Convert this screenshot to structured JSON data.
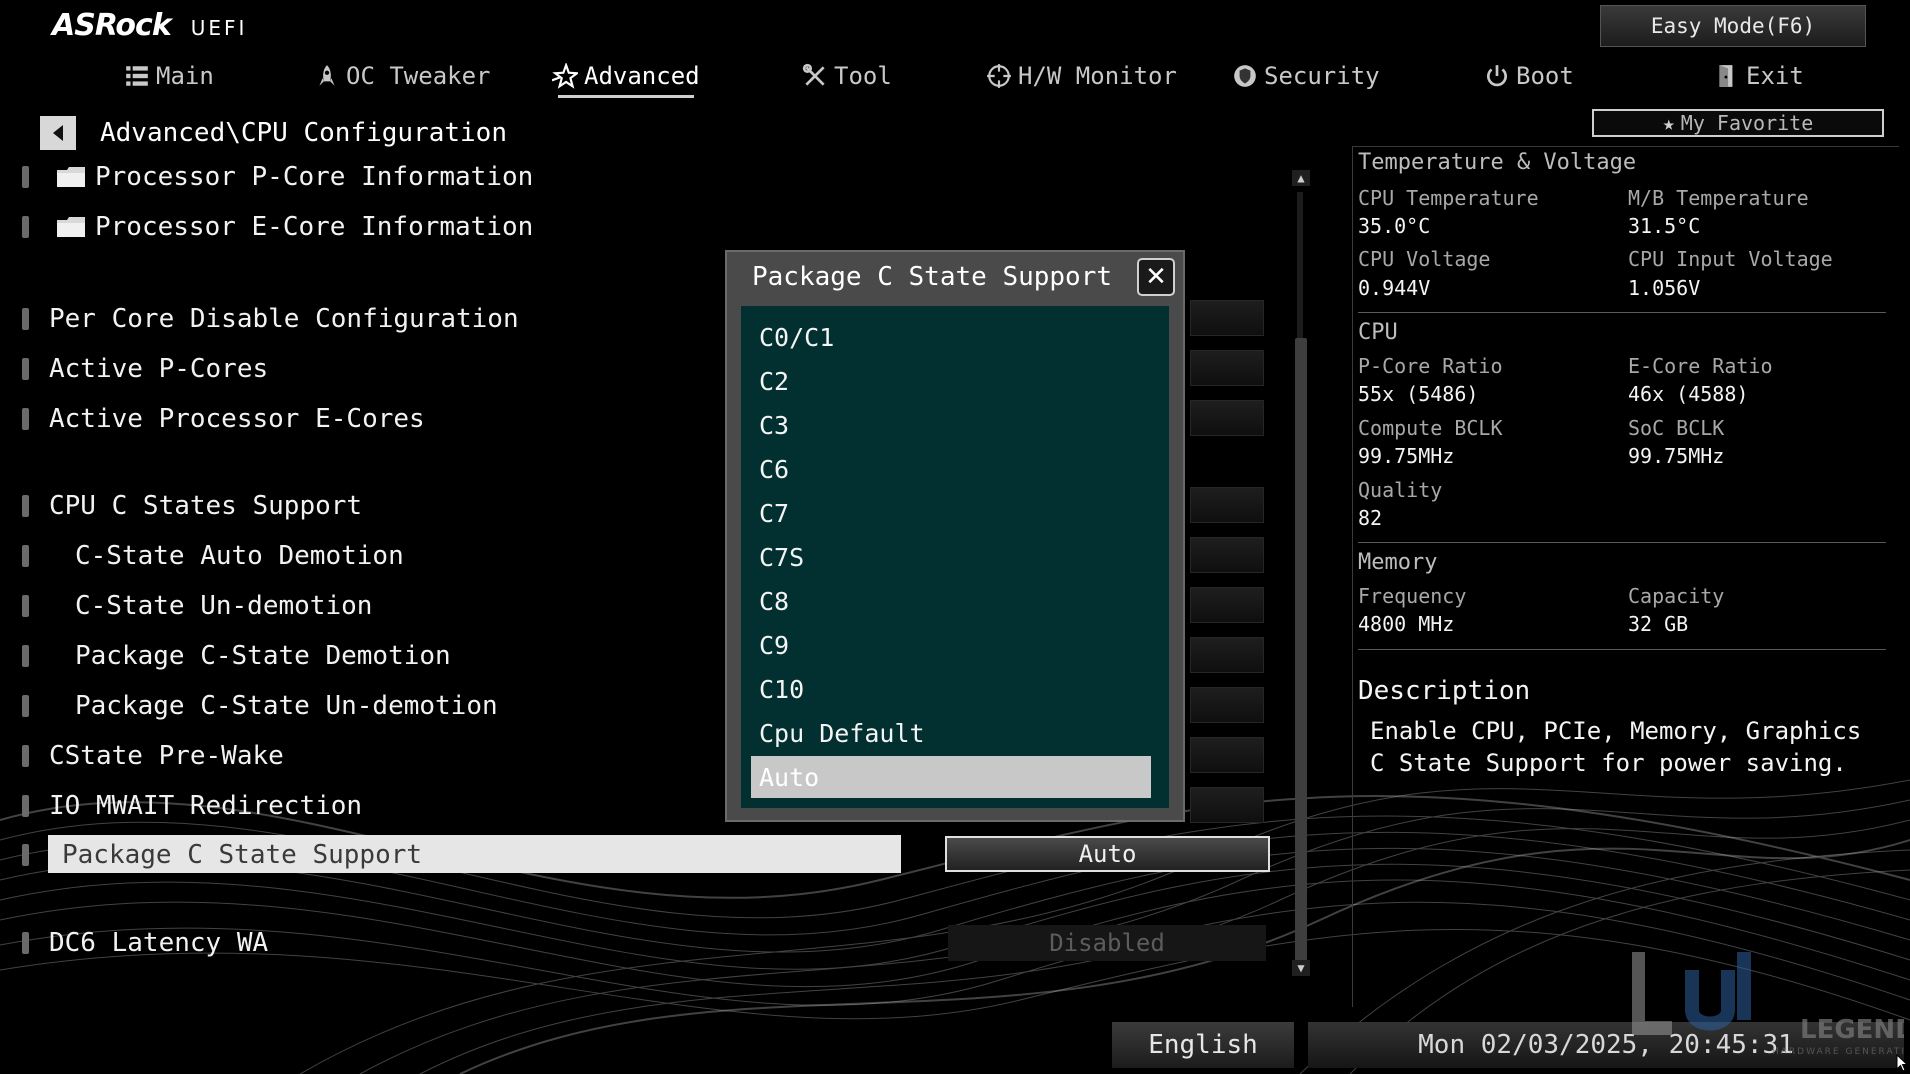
{
  "header": {
    "brand": "ASRock",
    "subbrand": "UEFI",
    "easy_mode": "Easy Mode(F6)",
    "my_favorite": "My Favorite"
  },
  "nav": [
    {
      "label": "Main",
      "icon": "list-icon",
      "active": false
    },
    {
      "label": "OC Tweaker",
      "icon": "rocket-icon",
      "active": false
    },
    {
      "label": "Advanced",
      "icon": "star-icon",
      "active": true
    },
    {
      "label": "Tool",
      "icon": "tools-icon",
      "active": false
    },
    {
      "label": "H/W Monitor",
      "icon": "crosshair-icon",
      "active": false
    },
    {
      "label": "Security",
      "icon": "shield-icon",
      "active": false
    },
    {
      "label": "Boot",
      "icon": "power-icon",
      "active": false
    },
    {
      "label": "Exit",
      "icon": "exit-door-icon",
      "active": false
    }
  ],
  "breadcrumb": "Advanced\\CPU Configuration",
  "settings": [
    {
      "label": "Processor P-Core Information",
      "folder": true
    },
    {
      "label": "Processor E-Core Information",
      "folder": true
    },
    {
      "label": "Per Core Disable Configuration"
    },
    {
      "label": "Active P-Cores"
    },
    {
      "label": "Active Processor E-Cores"
    },
    {
      "label": "CPU C States Support"
    },
    {
      "label": "C-State Auto Demotion",
      "indent": true
    },
    {
      "label": "C-State Un-demotion",
      "indent": true
    },
    {
      "label": "Package C-State Demotion",
      "indent": true
    },
    {
      "label": "Package C-State Un-demotion",
      "indent": true
    },
    {
      "label": "CState Pre-Wake"
    },
    {
      "label": "IO MWAIT Redirection"
    },
    {
      "label": "Package C State Support",
      "selected": true,
      "value": "Auto"
    },
    {
      "label": "DC6 Latency WA",
      "value": "Disabled"
    }
  ],
  "popup": {
    "title": "Package C State Support",
    "options": [
      "C0/C1",
      "C2",
      "C3",
      "C6",
      "C7",
      "C7S",
      "C8",
      "C9",
      "C10",
      "Cpu Default",
      "Auto"
    ],
    "selected": "Auto"
  },
  "info": {
    "temp_voltage": {
      "title": "Temperature & Voltage",
      "cpu_temp_label": "CPU Temperature",
      "cpu_temp": "35.0°C",
      "mb_temp_label": "M/B Temperature",
      "mb_temp": "31.5°C",
      "cpu_volt_label": "CPU Voltage",
      "cpu_volt": "0.944V",
      "cpu_in_volt_label": "CPU Input Voltage",
      "cpu_in_volt": "1.056V"
    },
    "cpu": {
      "title": "CPU",
      "pcore_label": "P-Core Ratio",
      "pcore": "55x (5486)",
      "ecore_label": "E-Core Ratio",
      "ecore": "46x (4588)",
      "bclk_label": "Compute BCLK",
      "bclk": "99.75MHz",
      "soc_label": "SoC BCLK",
      "soc": "99.75MHz",
      "quality_label": "Quality",
      "quality": "82"
    },
    "memory": {
      "title": "Memory",
      "freq_label": "Frequency",
      "freq": "4800 MHz",
      "cap_label": "Capacity",
      "cap": "32 GB"
    },
    "description_title": "Description",
    "description": "Enable CPU, PCIe, Memory, Graphics C State Support for power saving."
  },
  "footer": {
    "language": "English",
    "datetime": "Mon 02/03/2025, 20:45:31"
  },
  "watermark": {
    "text": "LEGEND",
    "sub": "HARDWARE GENERATION"
  },
  "colors": {
    "popup_list_bg": "#023030",
    "selection_bg": "#e6e6e6"
  }
}
